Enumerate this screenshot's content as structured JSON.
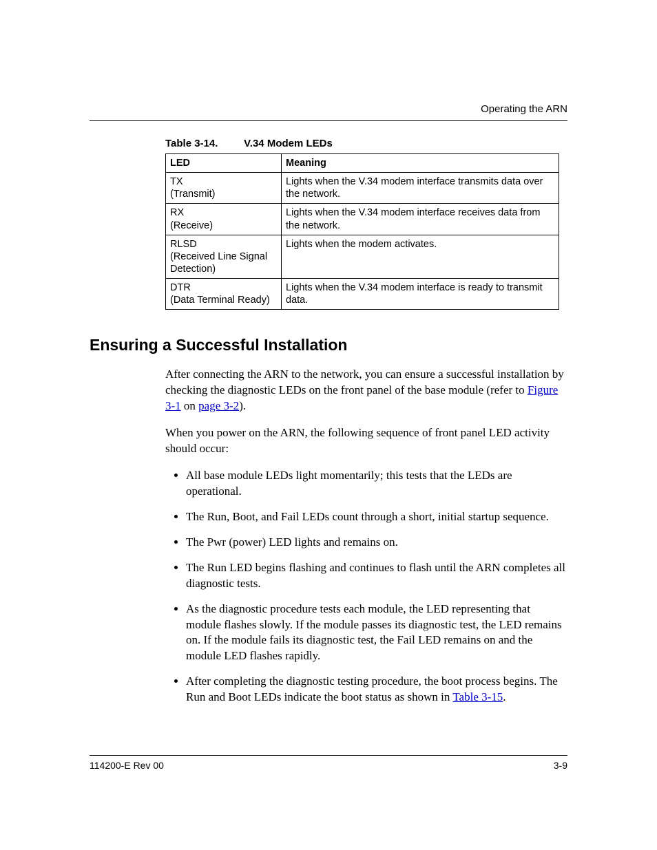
{
  "header": {
    "running_title": "Operating the ARN"
  },
  "table": {
    "caption_number": "Table 3-14.",
    "caption_title": "V.34 Modem LEDs",
    "head_led": "LED",
    "head_meaning": "Meaning",
    "rows": [
      {
        "led_line1": "TX",
        "led_line2": "(Transmit)",
        "meaning": "Lights when the V.34 modem interface transmits data over the network."
      },
      {
        "led_line1": "RX",
        "led_line2": "(Receive)",
        "meaning": "Lights when the V.34 modem interface receives data from the network."
      },
      {
        "led_line1": "RLSD",
        "led_line2": "(Received Line Signal Detection)",
        "meaning": "Lights when the modem activates."
      },
      {
        "led_line1": "DTR",
        "led_line2": "(Data Terminal Ready)",
        "meaning": "Lights when the V.34 modem interface is ready to transmit data."
      }
    ]
  },
  "section": {
    "heading": "Ensuring a Successful Installation",
    "para1_pre": "After connecting the ARN to the network, you can ensure a successful installation by checking the diagnostic LEDs on the front panel of the base module (refer to ",
    "para1_link1": "Figure 3-1",
    "para1_mid": " on ",
    "para1_link2": "page 3-2",
    "para1_post": ").",
    "para2": "When you power on the ARN, the following sequence of front panel LED activity should occur:",
    "bullets": [
      "All base module LEDs light momentarily; this tests that the LEDs are operational.",
      "The Run, Boot, and Fail LEDs count through a short, initial startup sequence.",
      "The Pwr (power) LED lights and remains on.",
      "The Run LED begins flashing and continues to flash until the ARN completes all diagnostic tests.",
      "As the diagnostic procedure tests each module, the LED representing that module flashes slowly. If the module passes its diagnostic test, the LED remains on. If the module fails its diagnostic test, the Fail LED remains on and the module LED flashes rapidly."
    ],
    "bullet_last_pre": "After completing the diagnostic testing procedure, the boot process begins. The Run and Boot LEDs indicate the boot status as shown in ",
    "bullet_last_link": "Table 3-15",
    "bullet_last_post": "."
  },
  "footer": {
    "left": "114200-E Rev 00",
    "right": "3-9"
  }
}
